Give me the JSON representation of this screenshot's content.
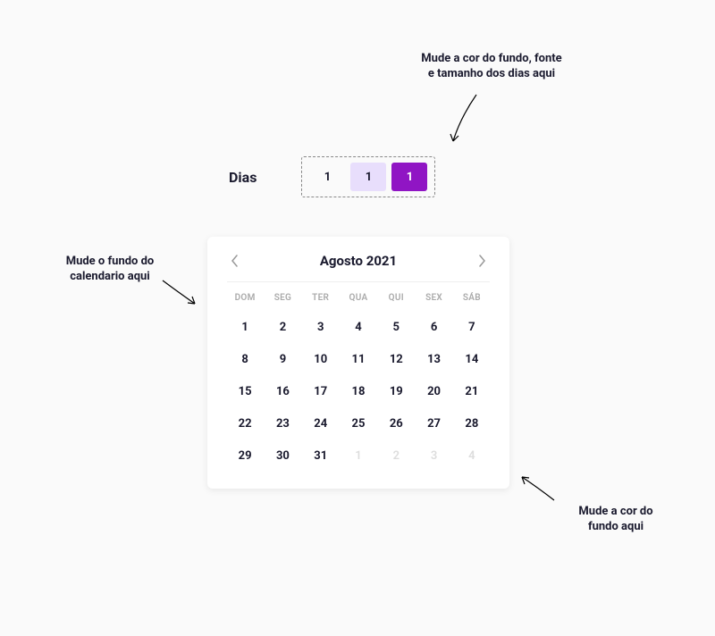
{
  "annotations": {
    "top": "Mude a cor do fundo, fonte e tamanho dos dias aqui",
    "left": "Mude o fundo do calendario aqui",
    "bottom": "Mude a cor do fundo aqui"
  },
  "dias": {
    "label": "Dias",
    "samples": [
      "1",
      "1",
      "1"
    ]
  },
  "calendar": {
    "title": "Agosto 2021",
    "weekdays": [
      "DOM",
      "SEG",
      "TER",
      "QUA",
      "QUI",
      "SEX",
      "SÁB"
    ],
    "days": [
      {
        "n": "1",
        "other": false
      },
      {
        "n": "2",
        "other": false
      },
      {
        "n": "3",
        "other": false
      },
      {
        "n": "4",
        "other": false
      },
      {
        "n": "5",
        "other": false
      },
      {
        "n": "6",
        "other": false
      },
      {
        "n": "7",
        "other": false
      },
      {
        "n": "8",
        "other": false
      },
      {
        "n": "9",
        "other": false
      },
      {
        "n": "10",
        "other": false
      },
      {
        "n": "11",
        "other": false
      },
      {
        "n": "12",
        "other": false
      },
      {
        "n": "13",
        "other": false
      },
      {
        "n": "14",
        "other": false
      },
      {
        "n": "15",
        "other": false
      },
      {
        "n": "16",
        "other": false
      },
      {
        "n": "17",
        "other": false
      },
      {
        "n": "18",
        "other": false
      },
      {
        "n": "19",
        "other": false
      },
      {
        "n": "20",
        "other": false
      },
      {
        "n": "21",
        "other": false
      },
      {
        "n": "22",
        "other": false
      },
      {
        "n": "23",
        "other": false
      },
      {
        "n": "24",
        "other": false
      },
      {
        "n": "25",
        "other": false
      },
      {
        "n": "26",
        "other": false
      },
      {
        "n": "27",
        "other": false
      },
      {
        "n": "28",
        "other": false
      },
      {
        "n": "29",
        "other": false
      },
      {
        "n": "30",
        "other": false
      },
      {
        "n": "31",
        "other": false
      },
      {
        "n": "1",
        "other": true
      },
      {
        "n": "2",
        "other": true
      },
      {
        "n": "3",
        "other": true
      },
      {
        "n": "4",
        "other": true
      }
    ]
  },
  "colors": {
    "selected": "#9015c4",
    "hover": "#e8defc"
  }
}
